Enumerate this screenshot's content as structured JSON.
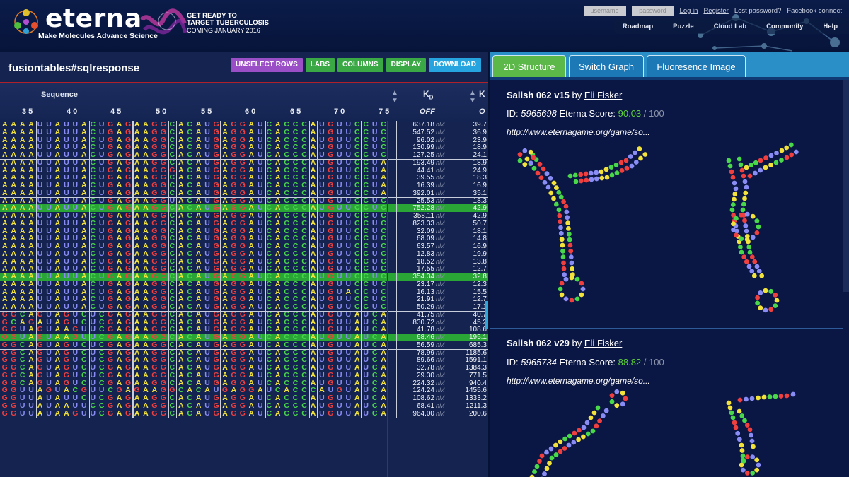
{
  "header": {
    "brand": "eterna",
    "tagline": "Make Molecules  Advance Science",
    "promo": [
      "GET READY TO",
      "TARGET TUBERCULOSIS",
      "COMING JANUARY 2016"
    ],
    "login": {
      "username_placeholder": "username",
      "password_placeholder": "password",
      "login": "Log in",
      "register": "Register",
      "lost_password": "Lost password?",
      "facebook": "Facebook connect"
    },
    "nav": [
      "Roadmap",
      "Puzzle",
      "Cloud Lab",
      "Community",
      "Help"
    ]
  },
  "left": {
    "title": "fusiontables#sqlresponse",
    "toolbar": [
      "UNSELECT ROWS",
      "LABS",
      "COLUMNS",
      "DISPLAY",
      "DOWNLOAD"
    ],
    "columns": {
      "sequence": "Sequence",
      "kd": "K",
      "kd_sub": "D",
      "k2": "K",
      "off": "OFF",
      "off2": "O"
    },
    "positions": [
      "35",
      "40",
      "45",
      "50",
      "55",
      "60",
      "65",
      "70",
      "75"
    ],
    "unit": "nM",
    "rows": [
      {
        "seq": "AAAAUUAUUACUGAGAAGGCACAUGAGGAUCACCCAUGUUCCUC",
        "kd": "637.18",
        "k2": "39.7",
        "hl": false,
        "gs": false
      },
      {
        "seq": "AAAAUUAUUACUGAGAAGGCACAUGAGGAUCACCCAUGUUCCUC",
        "kd": "547.52",
        "k2": "36.9",
        "hl": false,
        "gs": false
      },
      {
        "seq": "AAAAUUAUUACUGAGAAGGCACAUGAGGAUCACCCAUGUUCCUC",
        "kd": "96.02",
        "k2": "23.9",
        "hl": false,
        "gs": false
      },
      {
        "seq": "AAAAUUAUUACUGAGAAGGCACAUGAGGAUCACCCAUGUUCCUC",
        "kd": "130.99",
        "k2": "18.9",
        "hl": false,
        "gs": false
      },
      {
        "seq": "AAAAUUAUUACUGAGAAGGCACAUGAGGAUCACCCAUGUUCCUC",
        "kd": "127.25",
        "k2": "24.1",
        "hl": false,
        "gs": false
      },
      {
        "seq": "AAAAUUAUUACUGAGAAGGCACAUGAGGAUCACCCAUGUUCCUA",
        "kd": "193.49",
        "k2": "18.9",
        "hl": false,
        "gs": true
      },
      {
        "seq": "AAAAUUAUUACUGAGAAGGGACAUGAGGAUCACCCAUGUUCCUA",
        "kd": "44.41",
        "k2": "24.9",
        "hl": false,
        "gs": false
      },
      {
        "seq": "AAAAUUAUUACUGAGAAGGCACAUGAGGAUCACCCAUGUUCCUA",
        "kd": "39.55",
        "k2": "18.3",
        "hl": false,
        "gs": false
      },
      {
        "seq": "AAAAUUAUUACUGAGAAGGCACAUGAGGAUCACCCAUGUUCCUA",
        "kd": "16.39",
        "k2": "16.9",
        "hl": false,
        "gs": false
      },
      {
        "seq": "AAAAUUAUUACUGAGAAGGCACAUGAGGAUCACCCAUGUUCCUA",
        "kd": "392.01",
        "k2": "35.1",
        "hl": false,
        "gs": false
      },
      {
        "seq": "AAAAUUAUUACUGAGAAGGUACAUGAGGAUCACCCAUGUUCCUC",
        "kd": "25.53",
        "k2": "18.3",
        "hl": false,
        "gs": true
      },
      {
        "seq": "AAAAUUAUUACUGAGAAGGCACAUGAGGAUCACCCAUGUUCCUC",
        "kd": "752.28",
        "k2": "42.9",
        "hl": true,
        "gs": false
      },
      {
        "seq": "AAAAUUAUUACUGAGAAGGCACAUGAGGAUCACCCAUGUUCCUC",
        "kd": "358.11",
        "k2": "42.9",
        "hl": false,
        "gs": false
      },
      {
        "seq": "AAAAUUAUUACUGAGAAGGCACAUGAGGAUCACCCAUGUUCCUC",
        "kd": "823.33",
        "k2": "50.7",
        "hl": false,
        "gs": false
      },
      {
        "seq": "AAAAUUAUUACUGAGAAGGCACAUGAGGAUCACCCAUGUUCCUC",
        "kd": "32.09",
        "k2": "18.1",
        "hl": false,
        "gs": false
      },
      {
        "seq": "AAAAUUAUUACUGAGAAGGCACAUGAGGAUCACCCAUGUUCCUC",
        "kd": "68.09",
        "k2": "14.8",
        "hl": false,
        "gs": true
      },
      {
        "seq": "AAAAUUAUUACUGAGAAGGCACAUGAGGAUCACCCAUGUUCCUC",
        "kd": "63.57",
        "k2": "16.9",
        "hl": false,
        "gs": false
      },
      {
        "seq": "AAAAUUAUUACUGAGAAGGCACAUGAGGAUCACCCAUGUUCCUC",
        "kd": "12.83",
        "k2": "19.9",
        "hl": false,
        "gs": false
      },
      {
        "seq": "AAAAUUAUUACUGAGAAGGCACAUGAGGAUCACCCAUGUUCCUC",
        "kd": "18.52",
        "k2": "13.8",
        "hl": false,
        "gs": false
      },
      {
        "seq": "AAAAUUAUUACUGAGAAGGCACAUGAGGAUCACCCAUGUUCCUC",
        "kd": "17.55",
        "k2": "12.7",
        "hl": false,
        "gs": false
      },
      {
        "seq": "AAAAUUAUUACUGAGAAGGCACAUGAGGAUCACCCAUGUUCCUC",
        "kd": "354.34",
        "k2": "32.8",
        "hl": true,
        "gs": true
      },
      {
        "seq": "AAAAUUAUUACUGAGAAGGCACAUGAGGAUCACCCAUGUUCCUC",
        "kd": "23.17",
        "k2": "12.3",
        "hl": false,
        "gs": false
      },
      {
        "seq": "AAAAUUAUUACUGAGAAGGCACAUGAGGAUCACCCAUGUACCUC",
        "kd": "16.13",
        "k2": "15.5",
        "hl": false,
        "gs": false
      },
      {
        "seq": "AAAAUUAUUACUGAGAAGGCACAUGAGGAUCACCCAUGUUCCUC",
        "kd": "21.91",
        "k2": "12.7",
        "hl": false,
        "gs": false
      },
      {
        "seq": "AAAAUUAUUACUGAGAAGGCACAUGAGGAUCACCCAUGUUCCUC",
        "kd": "50.29",
        "k2": "17.1",
        "hl": false,
        "gs": false
      },
      {
        "seq": "GGCAGUAGUCUCGAGAAGGCACAUGAGGAUCACCCAUGUUAUCA",
        "kd": "41.75",
        "k2": "40.7",
        "hl": false,
        "gs": true
      },
      {
        "seq": "GCAGAUAGUCUCGAGAAGGCACAUGAGGAUCACCCAUGUUAUCA",
        "kd": "830.72",
        "k2": "45.2",
        "hl": false,
        "gs": false
      },
      {
        "seq": "GGUAGUAAGUUCGAGAAGGCACAUGAGGAUCACCCAUGUUAUCA",
        "kd": "41.78",
        "k2": "108.6",
        "hl": false,
        "gs": false
      },
      {
        "seq": "GGUAGUAAGUUCGAGAAGGCACAUGAGGAUCACCCAUGUUAUCA",
        "kd": "68.46",
        "k2": "195.1",
        "hl": true,
        "gs": false
      },
      {
        "seq": "GGCAGUAGUCUCGAGAAGGCACAUGAGGAUCACCCAUGUUAUCA",
        "kd": "56.59",
        "k2": "685.3",
        "hl": false,
        "gs": false
      },
      {
        "seq": "GGCAGUAGUCUCGAGAAGGCACAUGAGGAUCACCCAUGUUAUCA",
        "kd": "78.99",
        "k2": "1185.6",
        "hl": false,
        "gs": true
      },
      {
        "seq": "GGCAGUAGUCUCGAGAAGGCACAUGAGGAUCACCCAUGUUAUCA",
        "kd": "89.66",
        "k2": "1591.1",
        "hl": false,
        "gs": false
      },
      {
        "seq": "GGCAGUAGUCUCGAGAAGGCACAUGAGGAUCACCCAUGUUAUCA",
        "kd": "32.78",
        "k2": "1384.3",
        "hl": false,
        "gs": false
      },
      {
        "seq": "GGCAGUAGUCUCGAGAAGGCACAUGAGGAUCACCCAUGUUAUCA",
        "kd": "29.30",
        "k2": "771.5",
        "hl": false,
        "gs": false
      },
      {
        "seq": "GGCAGUAGUCUCGAGAAGGCACAUGAGGAUCACCCAUGUUAUCA",
        "kd": "224.32",
        "k2": "940.4",
        "hl": false,
        "gs": false
      },
      {
        "seq": "GGUUAGUACGUUCGAGAAGGCACAUGAGGAUCACCCAUGUAUCA",
        "kd": "124.24",
        "k2": "1455.6",
        "hl": false,
        "gs": true
      },
      {
        "seq": "GGUUAUAUUCUCGAGAAGGCACAUGAGGAUCACCCAUGUUAUCA",
        "kd": "108.62",
        "k2": "1333.2",
        "hl": false,
        "gs": false
      },
      {
        "seq": "GGUUAUAAUUCCGAGAAGGCACAUGAGGAUCACCCAUGUUAUCA",
        "kd": "68.41",
        "k2": "1211.3",
        "hl": false,
        "gs": false
      },
      {
        "seq": "GGUUAUAAGUUCGAGAAGGCACAUGAGGAUCACCCAUGUUAUCA",
        "kd": "964.00",
        "k2": "200.6",
        "hl": false,
        "gs": false
      }
    ],
    "colors": {
      "A": "#f2e23a",
      "U": "#8a8cf5",
      "G": "#ef3f3f",
      "C": "#48d84a",
      "highlight": "#29a636"
    }
  },
  "right": {
    "tabs": [
      "2D Structure",
      "Switch Graph",
      "Fluoresence Image"
    ],
    "cards": [
      {
        "name": "Salish 062 v15",
        "by": "by",
        "author": "Eli Fisker",
        "id_label": "ID:",
        "id": "5965698",
        "score_label": "Eterna Score:",
        "score": "90.03",
        "of": "/ 100",
        "url": "http://www.eternagame.org/game/so..."
      },
      {
        "name": "Salish 062 v29",
        "by": "by",
        "author": "Eli Fisker",
        "id_label": "ID:",
        "id": "5965734",
        "score_label": "Eterna Score:",
        "score": "88.82",
        "of": "/ 100",
        "url": "http://www.eternagame.org/game/so..."
      }
    ]
  }
}
